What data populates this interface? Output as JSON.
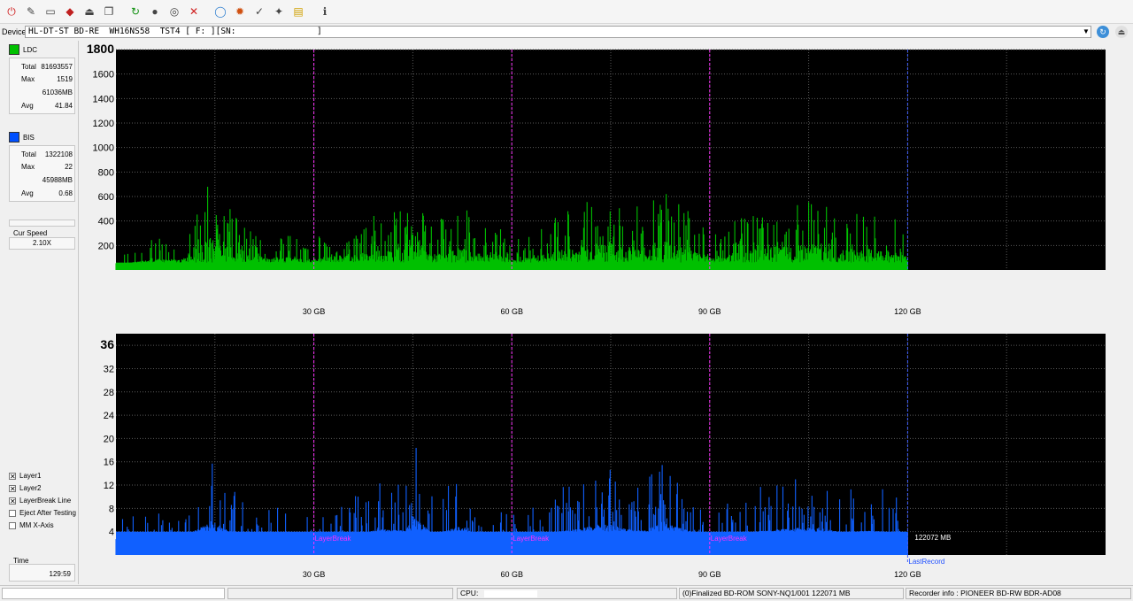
{
  "device": {
    "label": "Device:",
    "value": "HL-DT-ST BD-RE  WH16NS58  TST4 [ F: ][SN:                ]"
  },
  "toolbar_icons": [
    "power-icon",
    "settings-icon",
    "drive-icon",
    "disc-red-icon",
    "eject-icon",
    "copy-icon",
    "refresh-icon",
    "disc-black-icon",
    "scan-icon",
    "stop-icon",
    "blank-disc-icon",
    "burn-icon",
    "verify-icon",
    "erase-icon",
    "chart-icon",
    "info-icon"
  ],
  "ldc": {
    "label": "LDC",
    "color": "#00c000",
    "total_label": "Total",
    "total": "81693557",
    "max_label": "Max",
    "max": "1519",
    "max_pos": "61036MB",
    "avg_label": "Avg",
    "avg": "41.84"
  },
  "bis": {
    "label": "BIS",
    "color": "#0050ff",
    "total_label": "Total",
    "total": "1322108",
    "max_label": "Max",
    "max": "22",
    "max_pos": "45988MB",
    "avg_label": "Avg",
    "avg": "0.68"
  },
  "cur_speed": {
    "label": "Cur Speed",
    "value": "2.10X"
  },
  "options": [
    {
      "label": "Layer1",
      "checked": true
    },
    {
      "label": "Layer2",
      "checked": true
    },
    {
      "label": "LayerBreak Line",
      "checked": true
    },
    {
      "label": "Eject After Testing",
      "checked": false
    },
    {
      "label": "MM X-Axis",
      "checked": false
    }
  ],
  "time": {
    "label": "Time",
    "value": "129:59"
  },
  "status": {
    "cpu_label": "CPU:",
    "disc_info": "(0)Finalized  BD-ROM  SONY-NQ1/001  122071 MB",
    "recorder": "Recorder info : PIONEER       BD-RW   BDR-AD08"
  },
  "chart_data": [
    {
      "type": "area",
      "series": [
        {
          "name": "LDC",
          "color": "#00c000"
        }
      ],
      "x_range_gb": [
        0,
        150
      ],
      "data_end_gb": 120,
      "ylim": [
        0,
        1800
      ],
      "y_ticks": [
        200,
        400,
        600,
        800,
        1000,
        1200,
        1400,
        1600,
        1800
      ],
      "x_ticks": [
        30,
        60,
        90,
        120
      ],
      "x_tick_labels": [
        "30 GB",
        "60 GB",
        "90 GB",
        "120 GB"
      ],
      "layer_breaks_gb": [
        30,
        60,
        90
      ],
      "baseline": 60,
      "samples": [
        {
          "x": 0,
          "y": 110
        },
        {
          "x": 3,
          "y": 190
        },
        {
          "x": 6,
          "y": 260
        },
        {
          "x": 10,
          "y": 250
        },
        {
          "x": 14.5,
          "y": 780
        },
        {
          "x": 17,
          "y": 530
        },
        {
          "x": 20,
          "y": 350
        },
        {
          "x": 25,
          "y": 300
        },
        {
          "x": 30,
          "y": 260
        },
        {
          "x": 33,
          "y": 340
        },
        {
          "x": 38,
          "y": 420
        },
        {
          "x": 40,
          "y": 510
        },
        {
          "x": 44,
          "y": 480
        },
        {
          "x": 45,
          "y": 880
        },
        {
          "x": 48,
          "y": 360
        },
        {
          "x": 52,
          "y": 560
        },
        {
          "x": 55,
          "y": 380
        },
        {
          "x": 58,
          "y": 440
        },
        {
          "x": 60,
          "y": 250
        },
        {
          "x": 63,
          "y": 300
        },
        {
          "x": 66,
          "y": 420
        },
        {
          "x": 70,
          "y": 550
        },
        {
          "x": 74,
          "y": 690
        },
        {
          "x": 77,
          "y": 560
        },
        {
          "x": 80,
          "y": 500
        },
        {
          "x": 83,
          "y": 780
        },
        {
          "x": 86,
          "y": 560
        },
        {
          "x": 90,
          "y": 300
        },
        {
          "x": 94,
          "y": 410
        },
        {
          "x": 98,
          "y": 520
        },
        {
          "x": 102,
          "y": 560
        },
        {
          "x": 106,
          "y": 600
        },
        {
          "x": 110,
          "y": 460
        },
        {
          "x": 114,
          "y": 500
        },
        {
          "x": 118,
          "y": 460
        },
        {
          "x": 120,
          "y": 380
        }
      ]
    },
    {
      "type": "area",
      "series": [
        {
          "name": "BIS",
          "color": "#1060ff"
        }
      ],
      "x_range_gb": [
        0,
        150
      ],
      "data_end_gb": 120,
      "ylim": [
        0,
        38
      ],
      "y_ticks": [
        4,
        8,
        12,
        16,
        20,
        24,
        28,
        32,
        36
      ],
      "x_ticks": [
        30,
        60,
        90,
        120
      ],
      "x_tick_labels": [
        "30 GB",
        "60 GB",
        "90 GB",
        "120 GB"
      ],
      "layer_breaks_gb": [
        30,
        60,
        90
      ],
      "layer_break_label": "LayerBreak",
      "last_record_label": "LastRecord",
      "end_label": "122072 MB",
      "baseline": 4,
      "samples": [
        {
          "x": 0,
          "y": 6
        },
        {
          "x": 3,
          "y": 7
        },
        {
          "x": 6,
          "y": 9
        },
        {
          "x": 10,
          "y": 8
        },
        {
          "x": 14.5,
          "y": 17
        },
        {
          "x": 17,
          "y": 12
        },
        {
          "x": 20,
          "y": 9
        },
        {
          "x": 25,
          "y": 8
        },
        {
          "x": 30,
          "y": 7
        },
        {
          "x": 33,
          "y": 9
        },
        {
          "x": 38,
          "y": 11
        },
        {
          "x": 40,
          "y": 13
        },
        {
          "x": 44,
          "y": 12
        },
        {
          "x": 45,
          "y": 21
        },
        {
          "x": 48,
          "y": 10
        },
        {
          "x": 52,
          "y": 14
        },
        {
          "x": 55,
          "y": 10
        },
        {
          "x": 58,
          "y": 11
        },
        {
          "x": 60,
          "y": 7
        },
        {
          "x": 63,
          "y": 8
        },
        {
          "x": 66,
          "y": 11
        },
        {
          "x": 70,
          "y": 13
        },
        {
          "x": 74,
          "y": 16
        },
        {
          "x": 77,
          "y": 13
        },
        {
          "x": 80,
          "y": 12
        },
        {
          "x": 83,
          "y": 17
        },
        {
          "x": 86,
          "y": 13
        },
        {
          "x": 90,
          "y": 8
        },
        {
          "x": 94,
          "y": 10
        },
        {
          "x": 98,
          "y": 12
        },
        {
          "x": 102,
          "y": 13
        },
        {
          "x": 106,
          "y": 14
        },
        {
          "x": 110,
          "y": 11
        },
        {
          "x": 114,
          "y": 12
        },
        {
          "x": 118,
          "y": 11
        },
        {
          "x": 120,
          "y": 9
        }
      ]
    }
  ]
}
